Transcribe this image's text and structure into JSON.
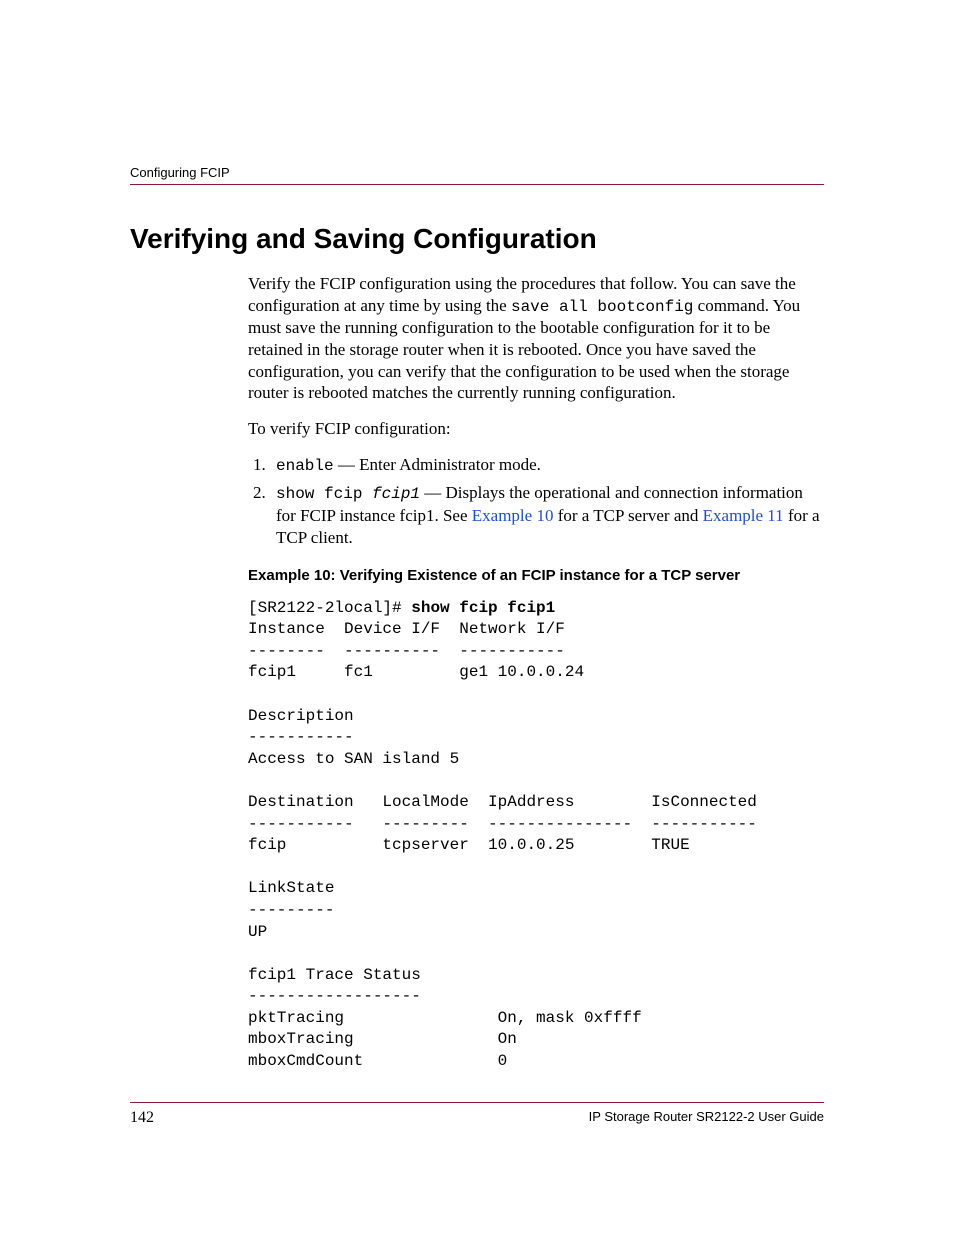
{
  "header": {
    "running_title": "Configuring FCIP"
  },
  "title": "Verifying and Saving Configuration",
  "intro": {
    "p1_pre": "Verify the FCIP configuration using the procedures that follow. You can save the configuration at any time by using the ",
    "p1_cmd": "save all bootconfig",
    "p1_post": " command. You must save the running configuration to the bootable configuration for it to be retained in the storage router when it is rebooted. Once you have saved the configuration, you can verify that the configuration to be used when the storage router is rebooted matches the currently running configuration.",
    "p2": "To verify FCIP configuration:"
  },
  "steps": {
    "s1_cmd": "enable",
    "s1_desc": " — Enter Administrator mode.",
    "s2_cmd1": "show fcip ",
    "s2_cmd2": "fcip1",
    "s2_desc_pre": " — Displays the operational and connection information for FCIP instance fcip1. See ",
    "s2_link1": "Example 10",
    "s2_mid": " for a TCP server and ",
    "s2_link2": "Example 11",
    "s2_post": " for a TCP client."
  },
  "example": {
    "title": "Example 10:  Verifying Existence of an FCIP instance for a TCP server",
    "prompt": "[SR2122-2local]# ",
    "command": "show fcip fcip1",
    "output": "Instance  Device I/F  Network I/F\n--------  ----------  -----------\nfcip1     fc1         ge1 10.0.0.24\n\nDescription\n-----------\nAccess to SAN island 5\n\nDestination   LocalMode  IpAddress        IsConnected\n-----------   ---------  ---------------  -----------\nfcip          tcpserver  10.0.0.25        TRUE\n\nLinkState\n---------\nUP\n\nfcip1 Trace Status\n------------------\npktTracing                On, mask 0xffff\nmboxTracing               On\nmboxCmdCount              0"
  },
  "footer": {
    "page_number": "142",
    "guide_title": "IP Storage Router SR2122-2 User Guide"
  }
}
